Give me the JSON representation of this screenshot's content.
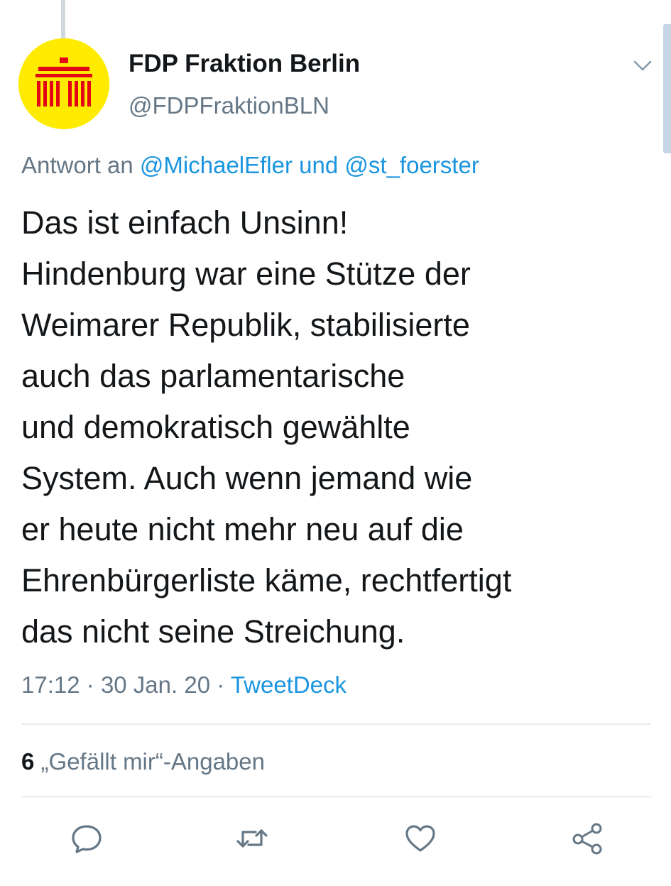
{
  "tweet": {
    "author": {
      "name": "FDP Fraktion Berlin",
      "handle": "@FDPFraktionBLN",
      "avatar_icon": "brandenburg-gate-logo",
      "avatar_bg": "#ffeb00",
      "avatar_fg": "#e30613"
    },
    "reply_to": {
      "prefix": "Antwort an",
      "mention_1": "@MichaelEfler",
      "conjunction": "und",
      "mention_2": "@st_foerster"
    },
    "text_lines": [
      "Das ist einfach Unsinn!",
      "Hindenburg war eine Stütze der",
      "Weimarer Republik, stabilisierte",
      "auch das parlamentarische",
      "und demokratisch gewählte",
      "System. Auch wenn jemand wie",
      "er heute nicht mehr neu auf die",
      "Ehrenbürgerliste käme, rechtfertigt",
      "das nicht seine Streichung."
    ],
    "meta": {
      "time": "17:12",
      "separator": "·",
      "date": "30 Jan. 20",
      "source": "TweetDeck"
    },
    "likes": {
      "count": "6",
      "label": "„Gefällt mir“-Angaben"
    },
    "actions": {
      "reply_icon": "reply-icon",
      "retweet_icon": "retweet-icon",
      "like_icon": "heart-icon",
      "share_icon": "share-icon"
    },
    "menu_icon": "chevron-down-icon"
  },
  "colors": {
    "link": "#1b95e0",
    "muted": "#657786",
    "text": "#14171a",
    "divider": "#e6ecf0"
  }
}
